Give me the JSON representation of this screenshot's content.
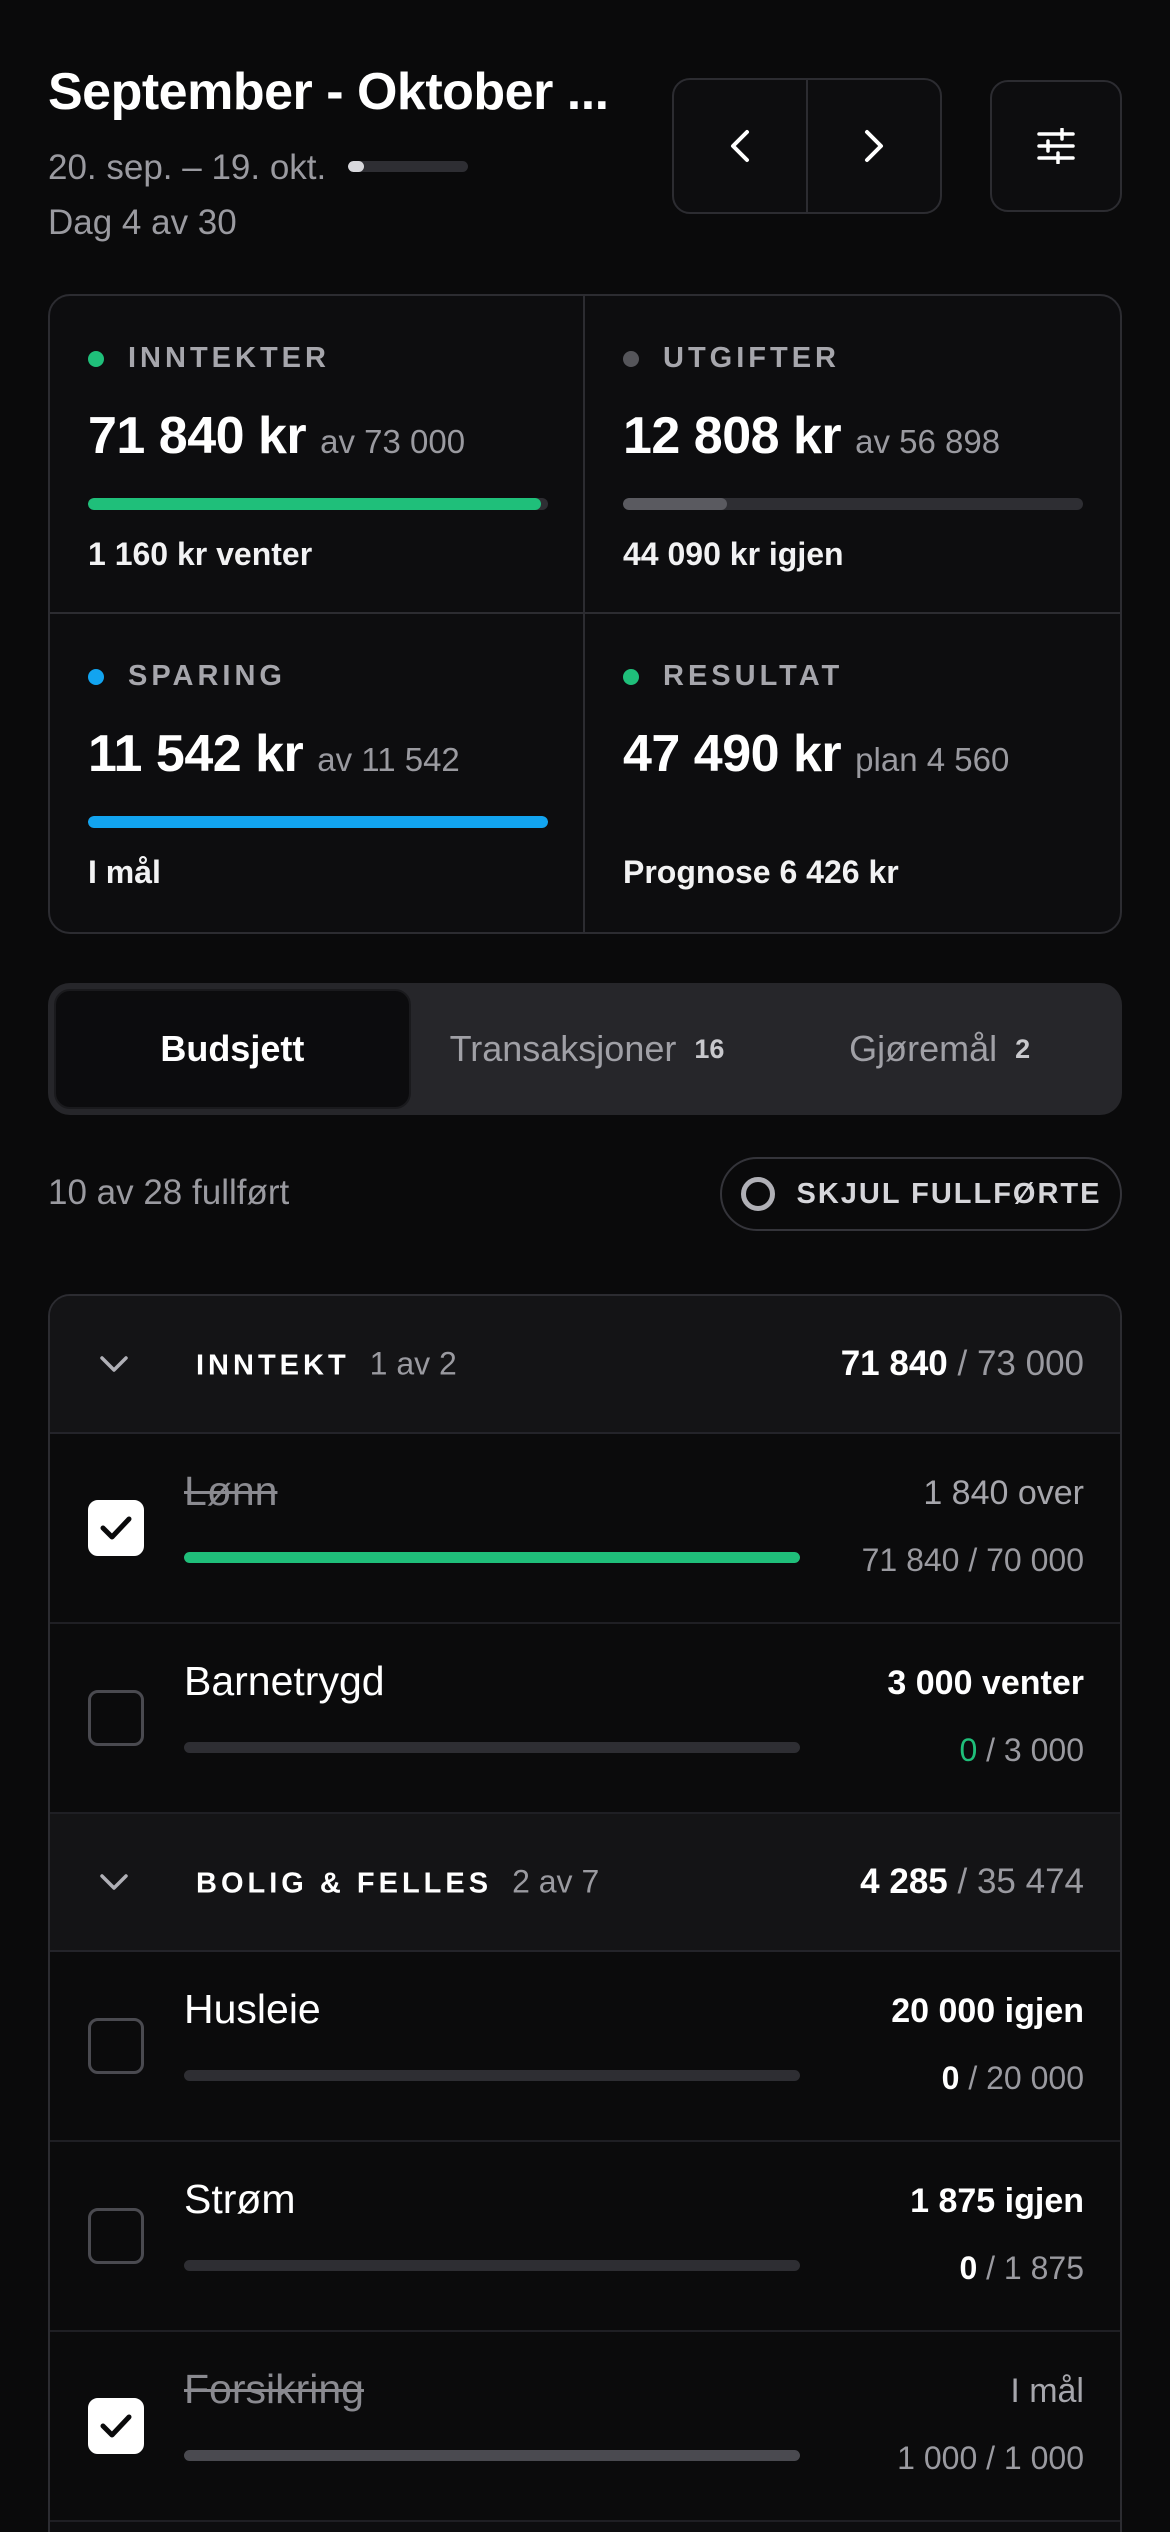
{
  "header": {
    "title": "September - Oktober ...",
    "date_range": "20. sep. – 19. okt.",
    "day_count": "Dag 4 av 30",
    "day_progress": 0.1333
  },
  "icons": {
    "prev": "chevron-left-icon",
    "next": "chevron-right-icon",
    "filter": "sliders-icon"
  },
  "stats": [
    {
      "label": "INNTEKTER",
      "value": "71 840 kr",
      "sub": "av 73 000",
      "note": "1 160 kr venter",
      "progress": 0.984,
      "color": "#1fbf7a"
    },
    {
      "label": "UTGIFTER",
      "value": "12 808 kr",
      "sub": "av 56 898",
      "note": "44 090 kr igjen",
      "progress": 0.225,
      "color": "#5a5a60"
    },
    {
      "label": "SPARING",
      "value": "11 542 kr",
      "sub": "av 11 542",
      "note": "I mål",
      "progress": 1.0,
      "color": "#12a4f0"
    },
    {
      "label": "RESULTAT",
      "value": "47 490 kr",
      "sub": "plan 4 560",
      "note": "Prognose 6 426 kr",
      "progress": null,
      "color": "#1fbf7a"
    }
  ],
  "stat_dot_colors": [
    "#1fbf7a",
    "#55555a",
    "#12a4f0",
    "#1fbf7a"
  ],
  "tabs": [
    {
      "label": "Budsjett",
      "count": "",
      "active": true
    },
    {
      "label": "Transaksjoner",
      "count": "16",
      "active": false
    },
    {
      "label": "Gjøremål",
      "count": "2",
      "active": false
    }
  ],
  "summary": {
    "completed": "10 av 28 fullført",
    "hide_label": "SKJUL FULLFØRTE"
  },
  "groups": [
    {
      "name": "INNTEKT",
      "count": "1 av 2",
      "spent": "71 840",
      "total": "/ 73 000",
      "items": [
        {
          "name": "Lønn",
          "done": true,
          "status": "1 840 over",
          "status_strong": false,
          "amount": "71 840",
          "of": "/ 70 000",
          "amount_color": "#9a9aa0",
          "progress": 1.0,
          "bar_color": "#1fbf7a"
        },
        {
          "name": "Barnetrygd",
          "done": false,
          "status": "3 000 venter",
          "status_strong": true,
          "amount": "0",
          "of": "/ 3 000",
          "amount_color": "#1fbf7a",
          "progress": 0,
          "bar_color": "#1fbf7a"
        }
      ]
    },
    {
      "name": "BOLIG & FELLES",
      "count": "2 av 7",
      "spent": "4 285",
      "total": "/ 35 474",
      "items": [
        {
          "name": "Husleie",
          "done": false,
          "status": "20 000 igjen",
          "status_strong": true,
          "amount": "0",
          "of": "/ 20 000",
          "amount_color": "#ffffff",
          "progress": 0,
          "bar_color": "#5a5a60"
        },
        {
          "name": "Strøm",
          "done": false,
          "status": "1 875 igjen",
          "status_strong": true,
          "amount": "0",
          "of": "/ 1 875",
          "amount_color": "#ffffff",
          "progress": 0,
          "bar_color": "#5a5a60"
        },
        {
          "name": "Forsikring",
          "done": true,
          "status": "I mål",
          "status_strong": false,
          "amount": "1 000",
          "of": "/ 1 000",
          "amount_color": "#9a9aa0",
          "progress": 1.0,
          "bar_color": "#4a4a50"
        }
      ]
    }
  ]
}
